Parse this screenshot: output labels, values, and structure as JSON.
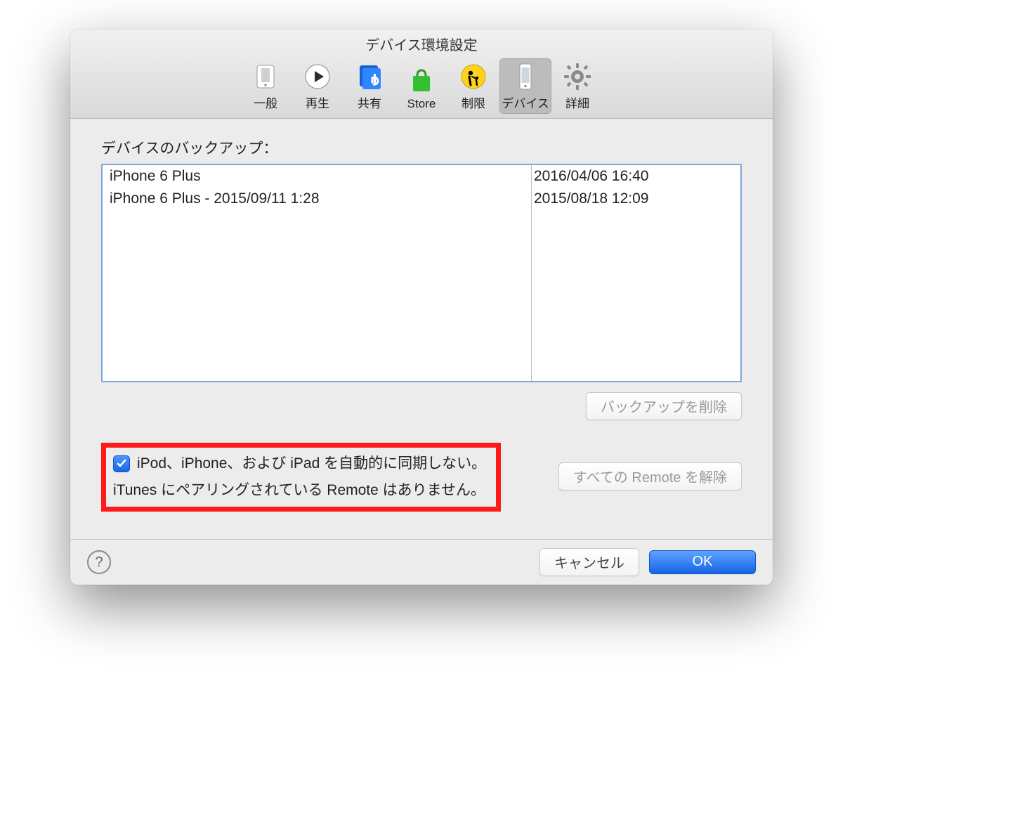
{
  "window": {
    "title": "デバイス環境設定"
  },
  "tabs": [
    {
      "label": "一般",
      "icon": "general-icon",
      "selected": false
    },
    {
      "label": "再生",
      "icon": "playback-icon",
      "selected": false
    },
    {
      "label": "共有",
      "icon": "sharing-icon",
      "selected": false
    },
    {
      "label": "Store",
      "icon": "store-icon",
      "selected": false
    },
    {
      "label": "制限",
      "icon": "parental-icon",
      "selected": false
    },
    {
      "label": "デバイス",
      "icon": "devices-icon",
      "selected": true
    },
    {
      "label": "詳細",
      "icon": "advanced-icon",
      "selected": false
    }
  ],
  "backups": {
    "label": "デバイスのバックアップ：",
    "rows": [
      {
        "name": "iPhone 6 Plus",
        "date": "2016/04/06 16:40"
      },
      {
        "name": "iPhone 6 Plus - 2015/09/11 1:28",
        "date": "2015/08/18 12:09"
      }
    ],
    "delete_label": "バックアップを削除"
  },
  "options": {
    "no_auto_sync_label": "iPod、iPhone、および iPad を自動的に同期しない。",
    "no_auto_sync_checked": true,
    "remote_note": "iTunes にペアリングされている Remote はありません。",
    "remove_remotes_label": "すべての Remote を解除"
  },
  "footer": {
    "cancel_label": "キャンセル",
    "ok_label": "OK"
  }
}
